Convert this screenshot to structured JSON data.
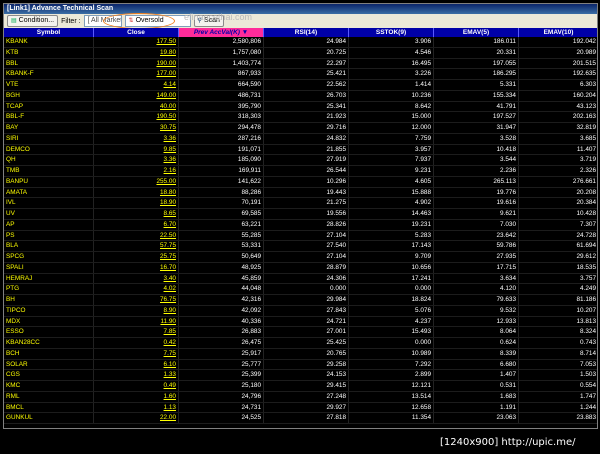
{
  "window": {
    "title": "[Link1] Advance Technical Scan"
  },
  "toolbar": {
    "condition_label": "Condition...",
    "filter_label": "Filter :",
    "filter_value": "[ All Market ]",
    "scan_type": "Oversold",
    "scan_label": "Scan",
    "watermark": "efinancethai.com"
  },
  "columns": [
    "Symbol",
    "Close",
    "Prev AccVal(K)",
    "RSI(14)",
    "SSTOK(9)",
    "EMAV(5)",
    "EMAV(10)"
  ],
  "rows": [
    [
      "KBANK",
      "177.50",
      "2,580,806",
      "24.984",
      "3.906",
      "186.011",
      "192.042"
    ],
    [
      "KTB",
      "19.80",
      "1,757,080",
      "20.725",
      "4.546",
      "20.331",
      "20.989"
    ],
    [
      "BBL",
      "190.00",
      "1,403,774",
      "22.297",
      "16.495",
      "197.055",
      "201.515"
    ],
    [
      "KBANK-F",
      "177.00",
      "867,933",
      "25.421",
      "3.226",
      "186.295",
      "192.635"
    ],
    [
      "VTE",
      "4.14",
      "664,590",
      "22.562",
      "1.414",
      "5.331",
      "6.303"
    ],
    [
      "BGH",
      "149.00",
      "486,731",
      "26.703",
      "10.236",
      "155.334",
      "160.204"
    ],
    [
      "TCAP",
      "40.00",
      "395,790",
      "25.341",
      "8.642",
      "41.791",
      "43.123"
    ],
    [
      "BBL-F",
      "190.50",
      "318,303",
      "21.923",
      "15.000",
      "197.527",
      "202.163"
    ],
    [
      "BAY",
      "30.75",
      "294,478",
      "29.716",
      "12.000",
      "31.947",
      "32.819"
    ],
    [
      "SIRI",
      "3.36",
      "287,216",
      "24.832",
      "7.759",
      "3.528",
      "3.685"
    ],
    [
      "DEMCO",
      "9.85",
      "191,071",
      "21.855",
      "3.957",
      "10.418",
      "11.407"
    ],
    [
      "QH",
      "3.36",
      "185,090",
      "27.919",
      "7.937",
      "3.544",
      "3.719"
    ],
    [
      "TMB",
      "2.16",
      "169,911",
      "26.544",
      "9.231",
      "2.236",
      "2.326"
    ],
    [
      "BANPU",
      "255.00",
      "141,622",
      "10.296",
      "4.605",
      "265.113",
      "276.661"
    ],
    [
      "AMATA",
      "18.80",
      "88,286",
      "19.443",
      "15.888",
      "19.776",
      "20.208"
    ],
    [
      "IVL",
      "18.90",
      "70,191",
      "21.275",
      "4.902",
      "19.616",
      "20.384"
    ],
    [
      "UV",
      "8.65",
      "69,585",
      "19.556",
      "14.463",
      "9.621",
      "10.428"
    ],
    [
      "AP",
      "6.70",
      "63,221",
      "28.826",
      "19.231",
      "7.030",
      "7.307"
    ],
    [
      "PS",
      "22.50",
      "55,285",
      "27.104",
      "5.283",
      "23.642",
      "24.728"
    ],
    [
      "BLA",
      "57.75",
      "53,331",
      "27.540",
      "17.143",
      "59.786",
      "61.694"
    ],
    [
      "SPCG",
      "25.75",
      "50,649",
      "27.104",
      "9.709",
      "27.935",
      "29.612"
    ],
    [
      "SPALI",
      "16.70",
      "48,925",
      "28.879",
      "10.656",
      "17.715",
      "18.535"
    ],
    [
      "HEMRAJ",
      "3.40",
      "45,859",
      "24.306",
      "17.241",
      "3.634",
      "3.757"
    ],
    [
      "PTG",
      "4.02",
      "44,048",
      "0.000",
      "0.000",
      "4.120",
      "4.249"
    ],
    [
      "BH",
      "76.75",
      "42,316",
      "29.984",
      "18.824",
      "79.633",
      "81.186"
    ],
    [
      "TIPCO",
      "8.90",
      "42,092",
      "27.843",
      "5.076",
      "9.532",
      "10.207"
    ],
    [
      "MDX",
      "11.90",
      "40,336",
      "24.721",
      "4.237",
      "12.933",
      "13.813"
    ],
    [
      "ESSO",
      "7.85",
      "26,883",
      "27.001",
      "15.493",
      "8.064",
      "8.324"
    ],
    [
      "KBAN28CC",
      "0.42",
      "26,475",
      "25.425",
      "0.000",
      "0.624",
      "0.743"
    ],
    [
      "BCH",
      "7.75",
      "25,917",
      "20.765",
      "10.989",
      "8.339",
      "8.714"
    ],
    [
      "SOLAR",
      "6.10",
      "25,777",
      "29.258",
      "7.292",
      "6.680",
      "7.053"
    ],
    [
      "CGS",
      "1.33",
      "25,399",
      "24.153",
      "2.899",
      "1.407",
      "1.503"
    ],
    [
      "KMC",
      "0.49",
      "25,180",
      "29.415",
      "12.121",
      "0.531",
      "0.554"
    ],
    [
      "RML",
      "1.60",
      "24,796",
      "27.248",
      "13.514",
      "1.683",
      "1.747"
    ],
    [
      "BMCL",
      "1.13",
      "24,731",
      "29.927",
      "12.658",
      "1.191",
      "1.244"
    ],
    [
      "GUNKUL",
      "22.00",
      "24,525",
      "27.818",
      "11.354",
      "23.063",
      "23.883"
    ]
  ],
  "caption": "[1240x900] http://upic.me/"
}
